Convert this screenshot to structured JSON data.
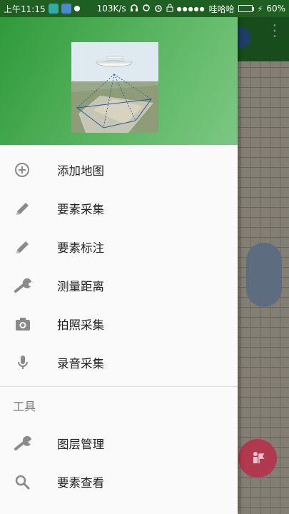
{
  "status_bar": {
    "time": "上午11:15",
    "net_speed": "103K/s",
    "signal_dots": "●●●●●",
    "carrier": "哇哈哈",
    "charging": "⚡",
    "battery": "60%",
    "battery_level": 0.6
  },
  "menu": {
    "items": [
      {
        "label": "添加地图",
        "icon": "add-circle-icon"
      },
      {
        "label": "要素采集",
        "icon": "pencil-icon"
      },
      {
        "label": "要素标注",
        "icon": "pencil-icon"
      },
      {
        "label": "测量距离",
        "icon": "wrench-icon"
      },
      {
        "label": "拍照采集",
        "icon": "camera-icon"
      },
      {
        "label": "录音采集",
        "icon": "microphone-icon"
      }
    ],
    "tools_section_title": "工具",
    "tools": [
      {
        "label": "图层管理",
        "icon": "wrench-icon"
      },
      {
        "label": "要素查看",
        "icon": "search-icon"
      }
    ]
  },
  "colors": {
    "header_green": "#2f9a3a",
    "toolbar_green": "#2e8b34",
    "fab": "#b0384f",
    "icon_gray": "#8a8a8a"
  }
}
